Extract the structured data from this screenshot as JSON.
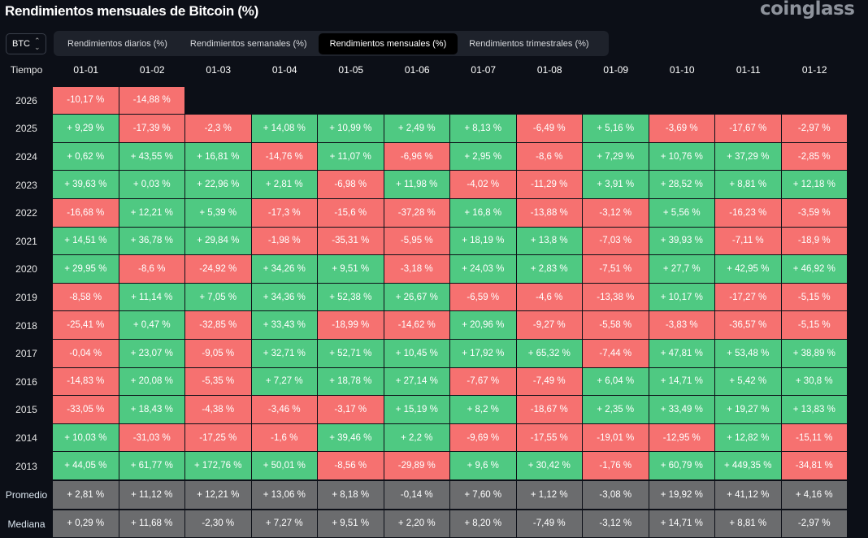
{
  "title": "Rendimientos mensuales de Bitcoin (%)",
  "logo": "coinglass",
  "asset_select": {
    "value": "BTC"
  },
  "tabs": [
    {
      "label": "Rendimientos diarios (%)",
      "active": false
    },
    {
      "label": "Rendimientos semanales (%)",
      "active": false
    },
    {
      "label": "Rendimientos mensuales (%)",
      "active": true
    },
    {
      "label": "Rendimientos trimestrales (%)",
      "active": false
    }
  ],
  "colors": {
    "positive": "#4fc982",
    "negative": "#f67170",
    "summary": "#6b6c6e",
    "background": "#0c0f17"
  },
  "table": {
    "corner": "Tiempo",
    "columns": [
      "01-01",
      "01-02",
      "01-03",
      "01-04",
      "01-05",
      "01-06",
      "01-07",
      "01-08",
      "01-09",
      "01-10",
      "01-11",
      "01-12"
    ],
    "rows": [
      {
        "year": "2026",
        "values": [
          "-10,17 %",
          "-14,88 %"
        ]
      },
      {
        "year": "2025",
        "values": [
          "+ 9,29 %",
          "-17,39 %",
          "-2,3 %",
          "+ 14,08 %",
          "+ 10,99 %",
          "+ 2,49 %",
          "+ 8,13 %",
          "-6,49 %",
          "+ 5,16 %",
          "-3,69 %",
          "-17,67 %",
          "-2,97 %"
        ]
      },
      {
        "year": "2024",
        "values": [
          "+ 0,62 %",
          "+ 43,55 %",
          "+ 16,81 %",
          "-14,76 %",
          "+ 11,07 %",
          "-6,96 %",
          "+ 2,95 %",
          "-8,6 %",
          "+ 7,29 %",
          "+ 10,76 %",
          "+ 37,29 %",
          "-2,85 %"
        ]
      },
      {
        "year": "2023",
        "values": [
          "+ 39,63 %",
          "+ 0,03 %",
          "+ 22,96 %",
          "+ 2,81 %",
          "-6,98 %",
          "+ 11,98 %",
          "-4,02 %",
          "-11,29 %",
          "+ 3,91 %",
          "+ 28,52 %",
          "+ 8,81 %",
          "+ 12,18 %"
        ]
      },
      {
        "year": "2022",
        "values": [
          "-16,68 %",
          "+ 12,21 %",
          "+ 5,39 %",
          "-17,3 %",
          "-15,6 %",
          "-37,28 %",
          "+ 16,8 %",
          "-13,88 %",
          "-3,12 %",
          "+ 5,56 %",
          "-16,23 %",
          "-3,59 %"
        ]
      },
      {
        "year": "2021",
        "values": [
          "+ 14,51 %",
          "+ 36,78 %",
          "+ 29,84 %",
          "-1,98 %",
          "-35,31 %",
          "-5,95 %",
          "+ 18,19 %",
          "+ 13,8 %",
          "-7,03 %",
          "+ 39,93 %",
          "-7,11 %",
          "-18,9 %"
        ]
      },
      {
        "year": "2020",
        "values": [
          "+ 29,95 %",
          "-8,6 %",
          "-24,92 %",
          "+ 34,26 %",
          "+ 9,51 %",
          "-3,18 %",
          "+ 24,03 %",
          "+ 2,83 %",
          "-7,51 %",
          "+ 27,7 %",
          "+ 42,95 %",
          "+ 46,92 %"
        ]
      },
      {
        "year": "2019",
        "values": [
          "-8,58 %",
          "+ 11,14 %",
          "+ 7,05 %",
          "+ 34,36 %",
          "+ 52,38 %",
          "+ 26,67 %",
          "-6,59 %",
          "-4,6 %",
          "-13,38 %",
          "+ 10,17 %",
          "-17,27 %",
          "-5,15 %"
        ]
      },
      {
        "year": "2018",
        "values": [
          "-25,41 %",
          "+ 0,47 %",
          "-32,85 %",
          "+ 33,43 %",
          "-18,99 %",
          "-14,62 %",
          "+ 20,96 %",
          "-9,27 %",
          "-5,58 %",
          "-3,83 %",
          "-36,57 %",
          "-5,15 %"
        ]
      },
      {
        "year": "2017",
        "values": [
          "-0,04 %",
          "+ 23,07 %",
          "-9,05 %",
          "+ 32,71 %",
          "+ 52,71 %",
          "+ 10,45 %",
          "+ 17,92 %",
          "+ 65,32 %",
          "-7,44 %",
          "+ 47,81 %",
          "+ 53,48 %",
          "+ 38,89 %"
        ]
      },
      {
        "year": "2016",
        "values": [
          "-14,83 %",
          "+ 20,08 %",
          "-5,35 %",
          "+ 7,27 %",
          "+ 18,78 %",
          "+ 27,14 %",
          "-7,67 %",
          "-7,49 %",
          "+ 6,04 %",
          "+ 14,71 %",
          "+ 5,42 %",
          "+ 30,8 %"
        ]
      },
      {
        "year": "2015",
        "values": [
          "-33,05 %",
          "+ 18,43 %",
          "-4,38 %",
          "-3,46 %",
          "-3,17 %",
          "+ 15,19 %",
          "+ 8,2 %",
          "-18,67 %",
          "+ 2,35 %",
          "+ 33,49 %",
          "+ 19,27 %",
          "+ 13,83 %"
        ]
      },
      {
        "year": "2014",
        "values": [
          "+ 10,03 %",
          "-31,03 %",
          "-17,25 %",
          "-1,6 %",
          "+ 39,46 %",
          "+ 2,2 %",
          "-9,69 %",
          "-17,55 %",
          "-19,01 %",
          "-12,95 %",
          "+ 12,82 %",
          "-15,11 %"
        ]
      },
      {
        "year": "2013",
        "values": [
          "+ 44,05 %",
          "+ 61,77 %",
          "+ 172,76 %",
          "+ 50,01 %",
          "-8,56 %",
          "-29,89 %",
          "+ 9,6 %",
          "+ 30,42 %",
          "-1,76 %",
          "+ 60,79 %",
          "+ 449,35 %",
          "-34,81 %"
        ]
      }
    ],
    "summary": [
      {
        "label": "Promedio",
        "values": [
          "+ 2,81 %",
          "+ 11,12 %",
          "+ 12,21 %",
          "+ 13,06 %",
          "+ 8,18 %",
          "-0,14 %",
          "+ 7,60 %",
          "+ 1,12 %",
          "-3,08 %",
          "+ 19,92 %",
          "+ 41,12 %",
          "+ 4,16 %"
        ]
      },
      {
        "label": "Mediana",
        "values": [
          "+ 0,29 %",
          "+ 11,68 %",
          "-2,30 %",
          "+ 7,27 %",
          "+ 9,51 %",
          "+ 2,20 %",
          "+ 8,20 %",
          "-7,49 %",
          "-3,12 %",
          "+ 14,71 %",
          "+ 8,81 %",
          "-2,97 %"
        ]
      }
    ]
  }
}
